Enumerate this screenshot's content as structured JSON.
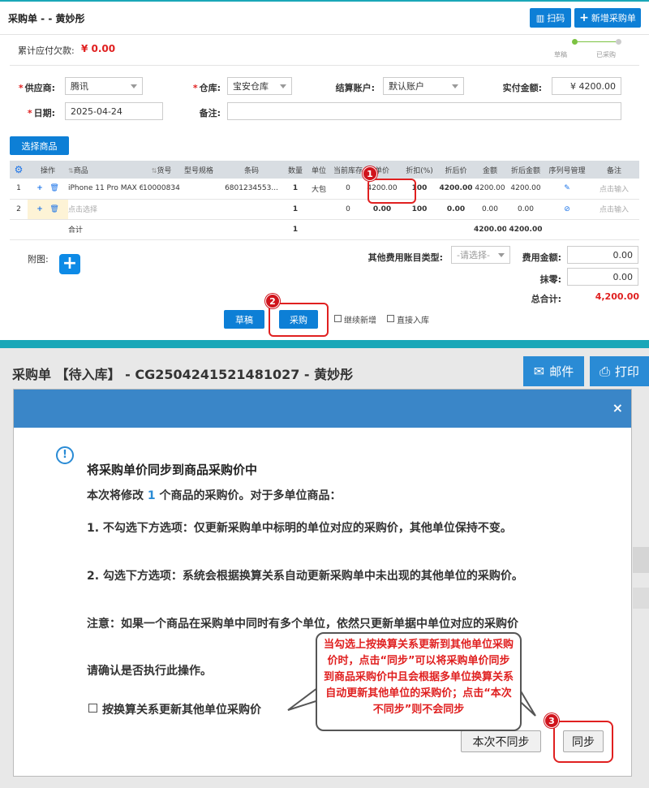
{
  "top": {
    "title": "采购单 - - 黄妙彤",
    "scan_label": "扫码",
    "new_order_label": "新增采购单",
    "owed_label": "累计应付欠款:",
    "owed_amount": "¥ 0.00",
    "steps": [
      "草稿",
      "已采购"
    ],
    "form": {
      "supplier_label": "供应商:",
      "supplier_value": "腾讯",
      "warehouse_label": "仓库:",
      "warehouse_value": "宝安仓库",
      "account_label": "结算账户:",
      "account_value": "默认账户",
      "paid_label": "实付金额:",
      "paid_value": "¥ 4200.00",
      "date_label": "日期:",
      "date_value": "2025-04-24",
      "remark_label": "备注:"
    },
    "choose_goods_label": "选择商品",
    "table": {
      "headers": [
        "操作",
        "商品",
        "货号",
        "型号规格",
        "条码",
        "数量",
        "单位",
        "当前库存",
        "单价",
        "折扣(%)",
        "折后价",
        "金额",
        "折后金额",
        "序列号管理",
        "备注"
      ],
      "rows": [
        {
          "idx": "1",
          "product": "iPhone 11 Pro MAX 6...",
          "sku": "10000834...",
          "spec": "",
          "barcode": "6801234553...",
          "qty": "1",
          "unit": "大包",
          "stock": "0",
          "price": "4200.00",
          "discount": "100",
          "disc_price": "4200.00",
          "amount": "4200.00",
          "disc_amount": "4200.00",
          "remark": "点击输入"
        },
        {
          "idx": "2",
          "product": "点击选择",
          "sku": "",
          "spec": "",
          "barcode": "",
          "qty": "1",
          "unit": "",
          "stock": "0",
          "price": "0.00",
          "discount": "100",
          "disc_price": "0.00",
          "amount": "0.00",
          "disc_amount": "0.00",
          "remark": "点击输入"
        }
      ],
      "total": {
        "label": "合计",
        "qty": "1",
        "amount": "4200.00",
        "disc_amount": "4200.00"
      }
    },
    "attach_label": "附图:",
    "other_fee_type_label": "其他费用账目类型:",
    "other_fee_type_placeholder": "-请选择-",
    "fee_amount_label": "费用金额:",
    "fee_amount_value": "0.00",
    "round_off_label": "抹零:",
    "round_off_value": "0.00",
    "grand_total_label": "总合计:",
    "grand_total_value": "4,200.00",
    "draft_label": "草稿",
    "purchase_label": "采购",
    "continue_add_label": "继续新增",
    "direct_stock_label": "直接入库"
  },
  "badges": [
    "1",
    "2",
    "3"
  ],
  "bottom": {
    "title": "采购单 【待入库】 - CG2504241521481027 - 黄妙彤",
    "mail_label": "邮件",
    "print_label": "打印"
  },
  "dialog": {
    "close": "×",
    "heading": "将采购单价同步到商品采购价中",
    "line1_pre": "本次将修改",
    "line1_count": "1",
    "line1_post": "个商品的采购价。对于多单位商品：",
    "para1": "1. 不勾选下方选项：仅更新采购单中标明的单位对应的采购价，其他单位保持不变。",
    "para2": "2. 勾选下方选项：系统会根据换算关系自动更新采购单中未出现的其他单位的采购价。",
    "para3": "注意：如果一个商品在采购单中同时有多个单位，依然只更新单据中单位对应的采购价",
    "confirm": "请确认是否执行此操作。",
    "checkbox_label": "按换算关系更新其他单位采购价",
    "no_sync_label": "本次不同步",
    "sync_label": "同步"
  },
  "callout": "当勾选上按换算关系更新到其他单位采购价时，点击“同步”可以将采购单价同步到商品采购价中且会根据多单位换算关系自动更新其他单位的采购价；点击“本次不同步”则不会同步",
  "colors": {
    "accent": "#0d7fd6",
    "teal": "#1aa7b8",
    "red": "#e02020",
    "dialog_header": "#3a86c8"
  }
}
